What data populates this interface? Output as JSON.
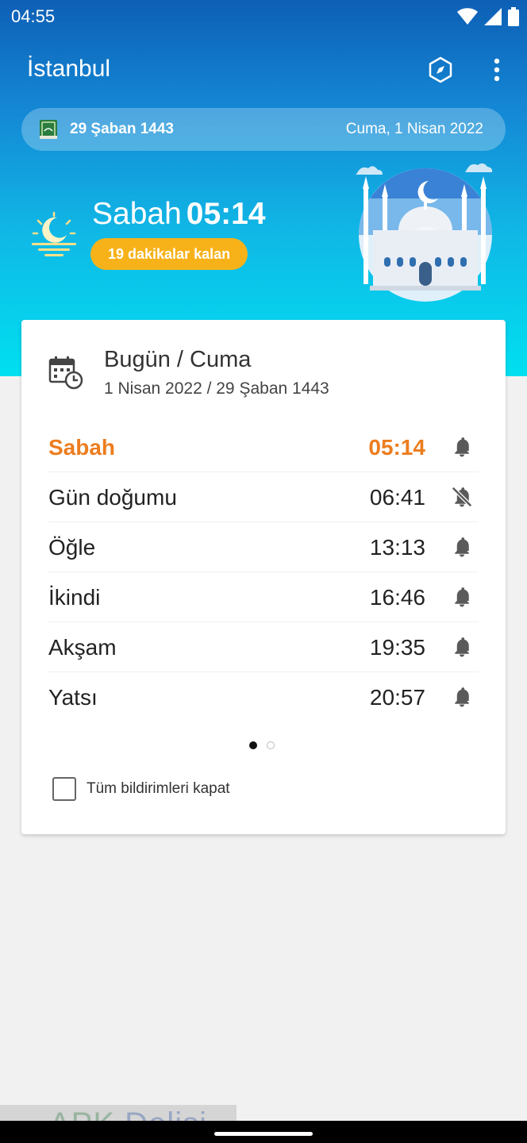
{
  "status_bar": {
    "time": "04:55",
    "icons": [
      "wifi-icon",
      "signal-icon",
      "battery-icon"
    ]
  },
  "app_bar": {
    "title": "İstanbul",
    "icons": [
      "compass-icon",
      "more-vert-icon"
    ]
  },
  "date_bar": {
    "icon": "quran-book-icon",
    "hijri_date": "29 Şaban 1443",
    "gregorian_date": "Cuma, 1 Nisan 2022"
  },
  "next_prayer": {
    "name": "Sabah",
    "time": "05:14",
    "remaining": "19 dakikalar kalan",
    "icon": "dawn-moon-icon"
  },
  "card": {
    "title": "Bugün / Cuma",
    "subtitle": "1 Nisan 2022 / 29 Şaban 1443",
    "prayers": [
      {
        "name": "Sabah",
        "time": "05:14",
        "notification": "on",
        "active": true
      },
      {
        "name": "Gün doğumu",
        "time": "06:41",
        "notification": "off",
        "active": false
      },
      {
        "name": "Öğle",
        "time": "13:13",
        "notification": "on",
        "active": false
      },
      {
        "name": "İkindi",
        "time": "16:46",
        "notification": "on",
        "active": false
      },
      {
        "name": "Akşam",
        "time": "19:35",
        "notification": "on",
        "active": false
      },
      {
        "name": "Yatsı",
        "time": "20:57",
        "notification": "on",
        "active": false
      }
    ],
    "pager": {
      "pages": 2,
      "current": 1
    },
    "mute_all": {
      "label": "Tüm bildirimleri kapat",
      "checked": false
    }
  },
  "watermark": {
    "text_1": "APK",
    "text_2": "Delisi"
  },
  "colors": {
    "accent_orange": "#ec7d1f",
    "badge_yellow": "#f7b21a",
    "header_blue": "#1486d4",
    "header_cyan": "#00e0f0"
  }
}
